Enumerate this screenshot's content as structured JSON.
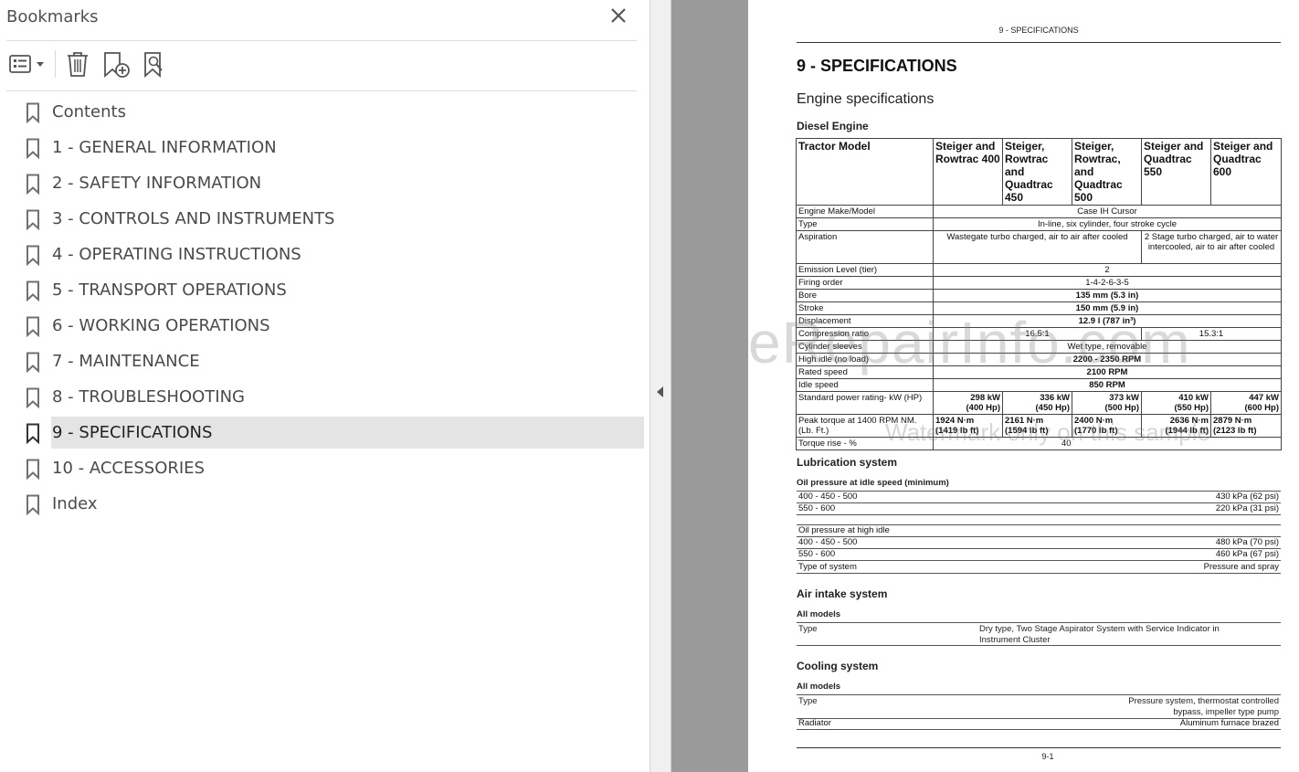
{
  "bookmarks_panel": {
    "title": "Bookmarks",
    "items": [
      {
        "label": "Contents",
        "selected": false
      },
      {
        "label": "1 - GENERAL INFORMATION",
        "selected": false
      },
      {
        "label": "2 - SAFETY INFORMATION",
        "selected": false
      },
      {
        "label": "3 - CONTROLS AND INSTRUMENTS",
        "selected": false
      },
      {
        "label": "4 - OPERATING INSTRUCTIONS",
        "selected": false
      },
      {
        "label": "5 - TRANSPORT OPERATIONS",
        "selected": false
      },
      {
        "label": "6 - WORKING OPERATIONS",
        "selected": false
      },
      {
        "label": "7 - MAINTENANCE",
        "selected": false
      },
      {
        "label": "8 - TROUBLESHOOTING",
        "selected": false
      },
      {
        "label": "9 - SPECIFICATIONS",
        "selected": true
      },
      {
        "label": "10 - ACCESSORIES",
        "selected": false
      },
      {
        "label": "Index",
        "selected": false
      }
    ],
    "toolbar_icons": [
      "options-menu-icon",
      "delete-bookmark-icon",
      "new-bookmark-icon",
      "find-bookmark-icon"
    ]
  },
  "document": {
    "running_header": "9 - SPECIFICATIONS",
    "chapter_title": "9 - SPECIFICATIONS",
    "section_title": "Engine specifications",
    "diesel": {
      "heading": "Diesel Engine",
      "header": [
        "Tractor Model",
        "Steiger and Rowtrac 400",
        "Steiger, Rowtrac and Quadtrac 450",
        "Steiger, Rowtrac, and Quadtrac 500",
        "Steiger and Quadtrac 550",
        "Steiger and Quadtrac 600"
      ],
      "engine_make_label": "Engine Make/Model",
      "engine_make_value": "Case IH Cursor",
      "type_label": "Type",
      "type_value": "In-line, six cylinder, four stroke cycle",
      "aspiration_label": "Aspiration",
      "aspiration_a": "Wastegate turbo charged, air to air after cooled",
      "aspiration_b": "2 Stage turbo charged, air to water intercooled, air to air after cooled",
      "emission_label": "Emission Level (tier)",
      "emission_value": "2",
      "firing_label": "Firing order",
      "firing_value": "1-4-2-6-3-5",
      "bore_label": "Bore",
      "bore_value": "135 mm (5.3 in)",
      "stroke_label": "Stroke",
      "stroke_value": "150 mm (5.9 in)",
      "displacement_label": "Displacement",
      "displacement_value": "12.9 l (787 in³)",
      "compression_label": "Compression ratio",
      "compression_a": "16.5:1",
      "compression_b": "15.3:1",
      "sleeves_label": "Cylinder sleeves",
      "sleeves_value": "Wet type, removable",
      "high_idle_label": "High idle (no load)",
      "high_idle_value": "2200 - 2350 RPM",
      "rated_label": "Rated speed",
      "rated_value": "2100 RPM",
      "idle_label": "Idle speed",
      "idle_value": "850 RPM",
      "power_label": "Standard power rating- kW (HP)",
      "power": [
        [
          "298 kW",
          "(400 Hp)"
        ],
        [
          "336 kW",
          "(450 Hp)"
        ],
        [
          "373 kW",
          "(500 Hp)"
        ],
        [
          "410 kW",
          "(550 Hp)"
        ],
        [
          "447 kW",
          "(600 Hp)"
        ]
      ],
      "torque_label": "Peak torque at 1400 RPM NM. (Lb. Ft.)",
      "torque": [
        [
          "1924 N·m",
          "(1419 lb ft)"
        ],
        [
          "2161 N·m",
          "(1594 lb ft)"
        ],
        [
          "2400 N·m",
          "(1770 lb ft)"
        ],
        [
          "2636 N·m",
          "(1944 lb ft)"
        ],
        [
          "2879 N·m",
          "(2123 lb ft)"
        ]
      ],
      "torque_rise_label": "Torque rise - %",
      "torque_rise_value": "40"
    },
    "lubrication": {
      "title": "Lubrication system",
      "idle_title": "Oil pressure at idle speed (minimum)",
      "idle_rows": [
        [
          "400 - 450 - 500",
          "430 kPa (62 psi)"
        ],
        [
          "550 - 600",
          "220 kPa (31 psi)"
        ]
      ],
      "high_title": "Oil pressure at high idle",
      "high_rows": [
        [
          "400 - 450 - 500",
          "480 kPa (70 psi)"
        ],
        [
          "550 - 600",
          "460 kPa (67 psi)"
        ],
        [
          "Type of system",
          "Pressure and spray"
        ]
      ]
    },
    "air_intake": {
      "title": "Air intake system",
      "subtitle": "All models",
      "type_label": "Type",
      "type_value_1": "Dry type, Two Stage Aspirator System with Service Indicator in",
      "type_value_2": "Instrument Cluster"
    },
    "cooling": {
      "title": "Cooling system",
      "subtitle": "All models",
      "type_label": "Type",
      "type_value_1": "Pressure system, thermostat controlled",
      "type_value_2": "bypass, impeller type pump",
      "radiator_label": "Radiator",
      "radiator_value": "Aluminum furnace brazed"
    },
    "watermark": "eRepairInfo.com",
    "watermark_sub": "Watermark only on this sample",
    "page_number": "9-1"
  }
}
